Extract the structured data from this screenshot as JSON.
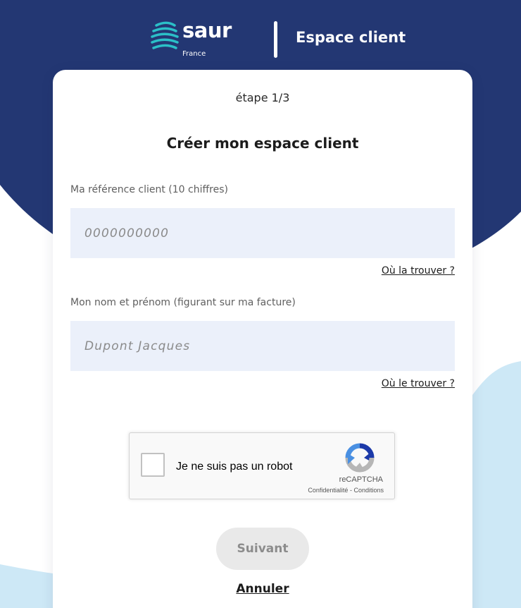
{
  "colors": {
    "navy": "#233773",
    "light_blue": "#cde8f6",
    "teal_logo": "#2bc0c8",
    "input_bg": "#ebf0fa",
    "button_disabled_bg": "#e9e9e9",
    "button_disabled_text": "#8c8c8c"
  },
  "header": {
    "logo_text": "saur",
    "logo_subtext": "France",
    "title": "Espace client"
  },
  "form": {
    "step": "étape 1/3",
    "title": "Créer mon espace client",
    "reference": {
      "label": "Ma référence client (10 chiffres)",
      "placeholder": "0000000000",
      "help_link": "Où la trouver ?"
    },
    "name": {
      "label": "Mon nom et prénom (figurant sur ma facture)",
      "placeholder": "Dupont Jacques",
      "help_link": "Où le trouver ?"
    },
    "recaptcha": {
      "label": "Je ne suis pas un robot",
      "brand": "reCAPTCHA",
      "privacy": "Confidentialité",
      "separator": "-",
      "terms": "Conditions"
    },
    "submit_label": "Suivant",
    "cancel_label": "Annuler"
  }
}
